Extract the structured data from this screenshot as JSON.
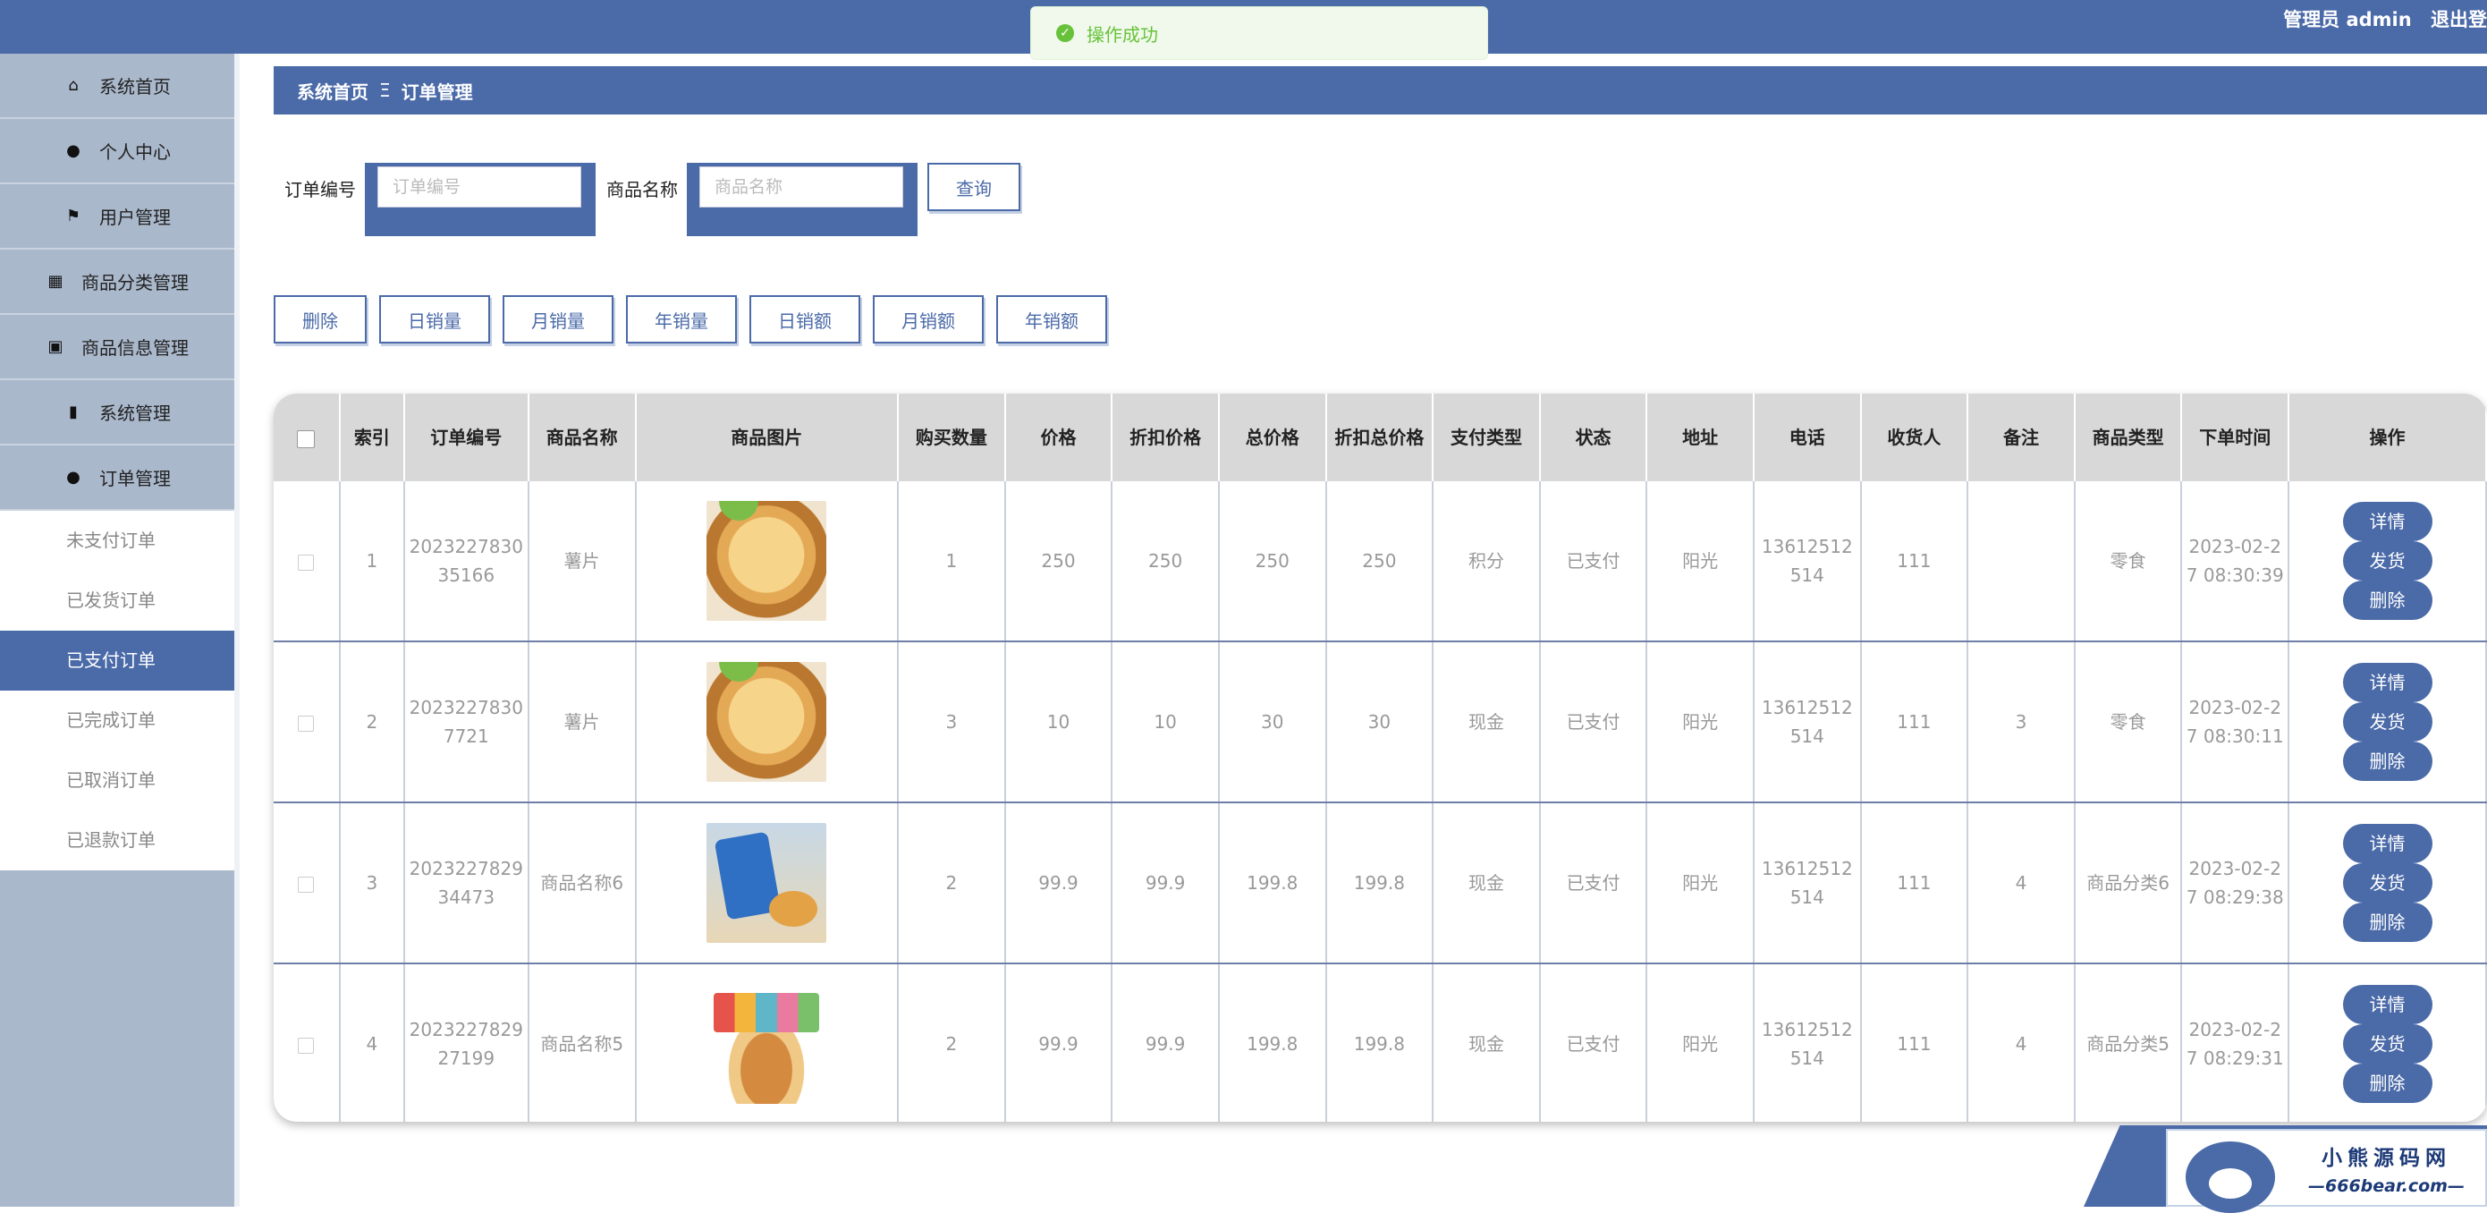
{
  "header": {
    "user": "管理员 admin",
    "logout": "退出登"
  },
  "toast": {
    "message": "操作成功"
  },
  "sidebar": {
    "items": [
      {
        "label": "系统首页",
        "icon": "home-icon"
      },
      {
        "label": "个人中心",
        "icon": "user-icon"
      },
      {
        "label": "用户管理",
        "icon": "flag-icon"
      },
      {
        "label": "商品分类管理",
        "icon": "grid-icon"
      },
      {
        "label": "商品信息管理",
        "icon": "clipboard-icon"
      },
      {
        "label": "系统管理",
        "icon": "bar-chart-icon"
      },
      {
        "label": "订单管理",
        "icon": "bulb-icon"
      }
    ],
    "subitems": [
      "未支付订单",
      "已发货订单",
      "已支付订单",
      "已完成订单",
      "已取消订单",
      "已退款订单"
    ],
    "active_sub": "已支付订单"
  },
  "breadcrumb": {
    "home": "系统首页",
    "separator": "Ξ",
    "current": "订单管理"
  },
  "search": {
    "order_no_label": "订单编号",
    "order_no_placeholder": "订单编号",
    "order_no_value": "",
    "product_label": "商品名称",
    "product_placeholder": "商品名称",
    "product_value": "",
    "query_button": "查询"
  },
  "actions": [
    "删除",
    "日销量",
    "月销量",
    "年销量",
    "日销额",
    "月销额",
    "年销额"
  ],
  "table": {
    "headers": [
      "索引",
      "订单编号",
      "商品名称",
      "商品图片",
      "购买数量",
      "价格",
      "折扣价格",
      "总价格",
      "折扣总价格",
      "支付类型",
      "状态",
      "地址",
      "电话",
      "收货人",
      "备注",
      "商品类型",
      "下单时间",
      "操作"
    ],
    "row_buttons": [
      "详情",
      "发货",
      "删除"
    ],
    "rows": [
      {
        "index": "1",
        "order_no": "2023227830​35166",
        "product": "薯片",
        "image": "chips",
        "qty": "1",
        "price": "250",
        "discount_price": "250",
        "total": "250",
        "discount_total": "250",
        "pay_type": "积分",
        "status": "已支付",
        "address": "阳光",
        "phone": "13612512514",
        "receiver": "111",
        "remark": "",
        "category": "零食",
        "time": "2023-02-27 08:30:39"
      },
      {
        "index": "2",
        "order_no": "202322783​07721",
        "product": "薯片",
        "image": "chips",
        "qty": "3",
        "price": "10",
        "discount_price": "10",
        "total": "30",
        "discount_total": "30",
        "pay_type": "现金",
        "status": "已支付",
        "address": "阳光",
        "phone": "13612512514",
        "receiver": "111",
        "remark": "3",
        "category": "零食",
        "time": "2023-02-27 08:30:11"
      },
      {
        "index": "3",
        "order_no": "202322782​934473",
        "product": "商品名称6",
        "image": "bag",
        "qty": "2",
        "price": "99.9",
        "discount_price": "99.9",
        "total": "199.8",
        "discount_total": "199.8",
        "pay_type": "现金",
        "status": "已支付",
        "address": "阳光",
        "phone": "13612512514",
        "receiver": "111",
        "remark": "4",
        "category": "商品分类6",
        "time": "2023-02-27 08:29:38"
      },
      {
        "index": "4",
        "order_no": "202322782​927199",
        "product": "商品名称5",
        "image": "cookies",
        "qty": "2",
        "price": "99.9",
        "discount_price": "99.9",
        "total": "199.8",
        "discount_total": "199.8",
        "pay_type": "现金",
        "status": "已支付",
        "address": "阳光",
        "phone": "13612512514",
        "receiver": "111",
        "remark": "4",
        "category": "商品分类5",
        "time": "2023-02-27 08:29:31"
      }
    ]
  },
  "watermark": {
    "name": "小熊源码网",
    "url": "—666bear.com—"
  },
  "colors": {
    "primary": "#4a6aa8",
    "sidebar": "#aab8cc",
    "success": "#67c23a"
  }
}
